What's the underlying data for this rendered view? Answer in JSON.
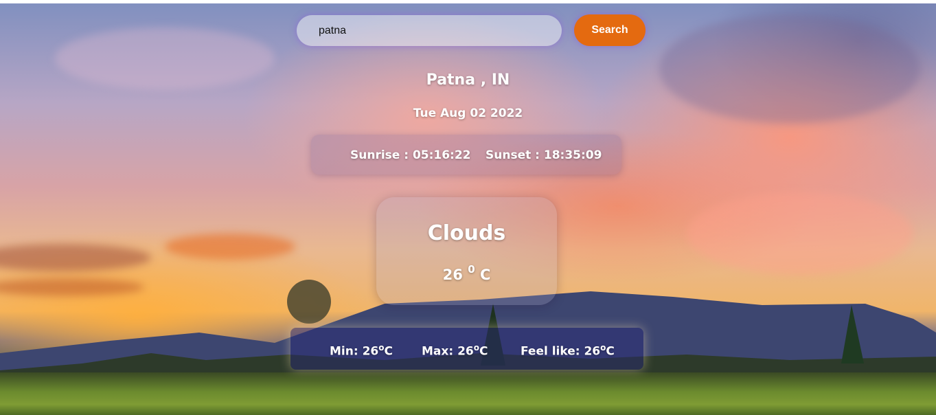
{
  "search": {
    "value": "patna",
    "button_label": "Search"
  },
  "location": {
    "city": "Patna , IN",
    "date": "Tue Aug 02 2022"
  },
  "sun": {
    "sunrise": "Sunrise : 05:16:22",
    "sunset": "Sunset : 18:35:09"
  },
  "weather": {
    "condition": "Clouds",
    "temp_value": "26",
    "temp_degree": "0",
    "temp_unit": "C"
  },
  "stats": {
    "min_label": "Min: 26",
    "min_unit": "C",
    "max_label": "Max: 26",
    "max_unit": "C",
    "feel_label": "Feel like: 26",
    "feel_unit": "C",
    "degree_mark": "o"
  },
  "colors": {
    "accent": "#e46a10"
  }
}
